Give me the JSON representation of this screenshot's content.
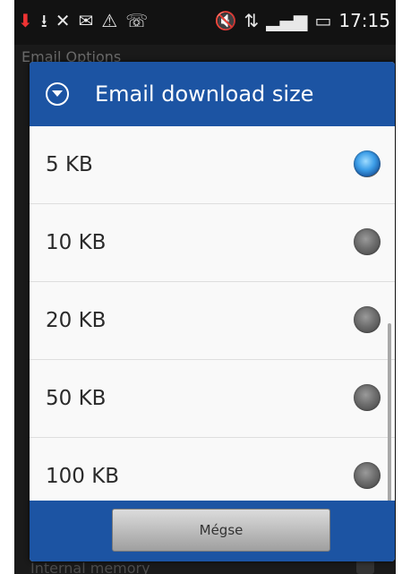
{
  "status_bar": {
    "icons": [
      "download-icon",
      "usb-icon",
      "signal-off-icon",
      "email-icon",
      "warning-icon",
      "missed-call-icon",
      "mute-icon",
      "network-3g-icon",
      "signal-bars-icon",
      "battery-icon"
    ],
    "time": "17:15"
  },
  "background": {
    "title": "Email Options",
    "bottom_text": "Internal memory"
  },
  "dialog": {
    "title": "Email download size",
    "options": [
      {
        "label": "5 KB",
        "selected": true
      },
      {
        "label": "10 KB",
        "selected": false
      },
      {
        "label": "20 KB",
        "selected": false
      },
      {
        "label": "50 KB",
        "selected": false
      },
      {
        "label": "100 KB",
        "selected": false
      }
    ],
    "button_label": "Mégse"
  },
  "colors": {
    "header_blue": "#1c54a3",
    "radio_selected": "#3d9ee8"
  }
}
